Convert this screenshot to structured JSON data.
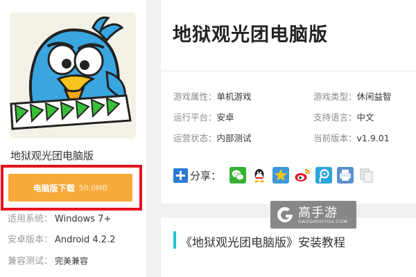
{
  "sidebar": {
    "app_name": "地狱观光团电脑版",
    "download": {
      "label": "电脑版下载",
      "size": "50.0MB"
    },
    "system_info": [
      {
        "key": "适用系统：",
        "value": "Windows 7+"
      },
      {
        "key": "安卓版本：",
        "value": "Android 4.2.2"
      },
      {
        "key": "兼容测试：",
        "value": "完美兼容"
      }
    ]
  },
  "main": {
    "title": "地狱观光团电脑版",
    "attributes": [
      {
        "key": "游戏属性：",
        "value": "单机游戏"
      },
      {
        "key": "游戏类型：",
        "value": "休闲益智"
      },
      {
        "key": "运行平台：",
        "value": "安卓"
      },
      {
        "key": "支持语言：",
        "value": "中文"
      },
      {
        "key": "运营状态：",
        "value": "内部测试"
      },
      {
        "key": "当前版本：",
        "value": "v1.9.01"
      }
    ],
    "share": {
      "label": "分享：",
      "icons": [
        "wechat-icon",
        "qq-icon",
        "qzone-icon",
        "weibo-icon",
        "tencent-weibo-icon",
        "print-icon",
        "copy-icon"
      ]
    }
  },
  "section": {
    "title": "《地狱观光团电脑版》安装教程"
  },
  "watermark": {
    "brand": "高手游",
    "domain": "GAOSHOUYOU.COM"
  },
  "colors": {
    "download_button": "#f7a93a",
    "highlight_border": "#e8121c",
    "section_accent": "#27c0d4",
    "share_plus": "#2b7ad6"
  }
}
